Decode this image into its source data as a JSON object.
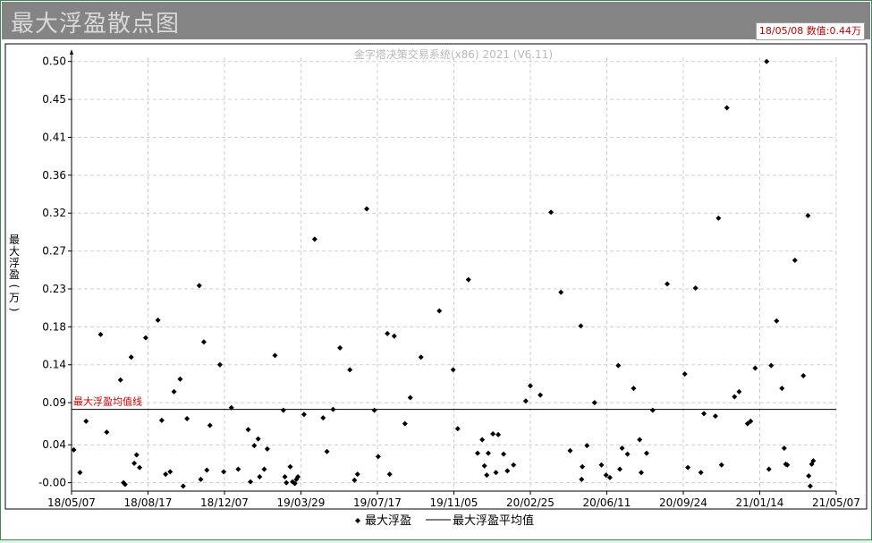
{
  "window": {
    "title": "最大浮盈散点图",
    "readout_date": "18/05/08",
    "readout_label": "数值:",
    "readout_value": "0.44万"
  },
  "chart_data": {
    "type": "scatter",
    "watermark": "金字塔决策交易系统(x86) 2021 (V6.11)",
    "ylabel": "最大浮盈(万)",
    "xlabel": "",
    "y_ticks": [
      "0.50",
      "0.45",
      "0.41",
      "0.36",
      "0.32",
      "0.27",
      "0.23",
      "0.18",
      "0.14",
      "0.09",
      "0.04",
      "-0.00"
    ],
    "y_tick_values": [
      0.5,
      0.455,
      0.41,
      0.365,
      0.32,
      0.275,
      0.23,
      0.185,
      0.14,
      0.095,
      0.045,
      0.0
    ],
    "x_ticks": [
      "18/05/07",
      "18/08/17",
      "18/12/07",
      "19/03/29",
      "19/07/17",
      "19/11/05",
      "20/02/25",
      "20/06/11",
      "20/09/24",
      "21/01/14",
      "21/05/07"
    ],
    "ylim": [
      -0.01,
      0.505
    ],
    "xlim": [
      0,
      100
    ],
    "grid": true,
    "series": [
      {
        "name": "最大浮盈",
        "color": "#000000",
        "points": [
          [
            0.3,
            0.039
          ],
          [
            1.1,
            0.012
          ],
          [
            1.9,
            0.073
          ],
          [
            3.8,
            0.176
          ],
          [
            4.6,
            0.06
          ],
          [
            6.4,
            0.122
          ],
          [
            6.8,
            0.0
          ],
          [
            7.0,
            -0.002
          ],
          [
            7.8,
            0.149
          ],
          [
            8.2,
            0.023
          ],
          [
            8.5,
            0.033
          ],
          [
            8.9,
            0.018
          ],
          [
            9.7,
            0.172
          ],
          [
            11.3,
            0.193
          ],
          [
            11.8,
            0.074
          ],
          [
            12.3,
            0.01
          ],
          [
            12.9,
            0.013
          ],
          [
            13.4,
            0.108
          ],
          [
            14.2,
            0.123
          ],
          [
            14.6,
            -0.004
          ],
          [
            15.1,
            0.076
          ],
          [
            16.7,
            0.234
          ],
          [
            16.9,
            0.004
          ],
          [
            17.3,
            0.167
          ],
          [
            17.7,
            0.015
          ],
          [
            18.1,
            0.068
          ],
          [
            19.4,
            0.14
          ],
          [
            19.9,
            0.013
          ],
          [
            20.9,
            0.089
          ],
          [
            21.8,
            0.016
          ],
          [
            23.1,
            0.063
          ],
          [
            23.4,
            0.001
          ],
          [
            23.9,
            0.044
          ],
          [
            24.4,
            0.052
          ],
          [
            24.6,
            0.007
          ],
          [
            25.2,
            0.016
          ],
          [
            25.6,
            0.04
          ],
          [
            26.6,
            0.151
          ],
          [
            27.7,
            0.086
          ],
          [
            27.9,
            0.007
          ],
          [
            28.1,
            0.0
          ],
          [
            28.6,
            0.019
          ],
          [
            28.9,
            0.001
          ],
          [
            29.2,
            -0.001
          ],
          [
            29.4,
            0.004
          ],
          [
            29.6,
            0.007
          ],
          [
            30.4,
            0.081
          ],
          [
            31.8,
            0.289
          ],
          [
            32.9,
            0.077
          ],
          [
            33.4,
            0.037
          ],
          [
            34.2,
            0.087
          ],
          [
            35.1,
            0.16
          ],
          [
            36.4,
            0.134
          ],
          [
            37.0,
            0.003
          ],
          [
            37.4,
            0.01
          ],
          [
            38.6,
            0.325
          ],
          [
            39.6,
            0.086
          ],
          [
            40.1,
            0.031
          ],
          [
            41.3,
            0.177
          ],
          [
            41.6,
            0.01
          ],
          [
            42.2,
            0.174
          ],
          [
            43.6,
            0.07
          ],
          [
            44.3,
            0.101
          ],
          [
            45.7,
            0.149
          ],
          [
            48.1,
            0.204
          ],
          [
            49.9,
            0.134
          ],
          [
            50.5,
            0.064
          ],
          [
            51.9,
            0.241
          ],
          [
            53.1,
            0.035
          ],
          [
            53.7,
            0.051
          ],
          [
            54.0,
            0.02
          ],
          [
            54.3,
            0.009
          ],
          [
            54.5,
            0.035
          ],
          [
            55.1,
            0.058
          ],
          [
            55.5,
            0.012
          ],
          [
            55.8,
            0.057
          ],
          [
            56.5,
            0.034
          ],
          [
            57.0,
            0.014
          ],
          [
            57.8,
            0.021
          ],
          [
            59.4,
            0.097
          ],
          [
            60.0,
            0.115
          ],
          [
            61.3,
            0.104
          ],
          [
            62.7,
            0.321
          ],
          [
            64.0,
            0.226
          ],
          [
            65.2,
            0.038
          ],
          [
            66.6,
            0.186
          ],
          [
            66.7,
            0.004
          ],
          [
            66.8,
            0.019
          ],
          [
            67.4,
            0.044
          ],
          [
            68.4,
            0.095
          ],
          [
            69.3,
            0.021
          ],
          [
            69.9,
            0.009
          ],
          [
            70.4,
            0.006
          ],
          [
            71.5,
            0.139
          ],
          [
            71.7,
            0.016
          ],
          [
            72.0,
            0.041
          ],
          [
            72.7,
            0.034
          ],
          [
            73.5,
            0.112
          ],
          [
            74.3,
            0.051
          ],
          [
            74.5,
            0.012
          ],
          [
            75.2,
            0.035
          ],
          [
            76.0,
            0.086
          ],
          [
            77.9,
            0.236
          ],
          [
            80.2,
            0.129
          ],
          [
            80.6,
            0.018
          ],
          [
            81.6,
            0.231
          ],
          [
            82.3,
            0.012
          ],
          [
            82.7,
            0.082
          ],
          [
            84.2,
            0.079
          ],
          [
            84.6,
            0.314
          ],
          [
            85.0,
            0.021
          ],
          [
            85.7,
            0.445
          ],
          [
            86.7,
            0.102
          ],
          [
            87.3,
            0.108
          ],
          [
            88.4,
            0.07
          ],
          [
            88.8,
            0.073
          ],
          [
            89.4,
            0.136
          ],
          [
            90.9,
            0.5
          ],
          [
            91.2,
            0.016
          ],
          [
            91.5,
            0.139
          ],
          [
            92.2,
            0.192
          ],
          [
            92.9,
            0.112
          ],
          [
            93.2,
            0.041
          ],
          [
            93.4,
            0.022
          ],
          [
            93.6,
            0.021
          ],
          [
            94.6,
            0.264
          ],
          [
            95.7,
            0.127
          ],
          [
            96.3,
            0.317
          ],
          [
            96.4,
            0.008
          ],
          [
            96.6,
            -0.004
          ],
          [
            96.8,
            0.022
          ],
          [
            97.0,
            0.026
          ]
        ]
      },
      {
        "name": "最大浮盈平均值",
        "color": "#000000",
        "average": 0.087
      }
    ],
    "avg_line_label": "最大浮盈均值线",
    "legend": {
      "position": "bottom-center"
    }
  }
}
